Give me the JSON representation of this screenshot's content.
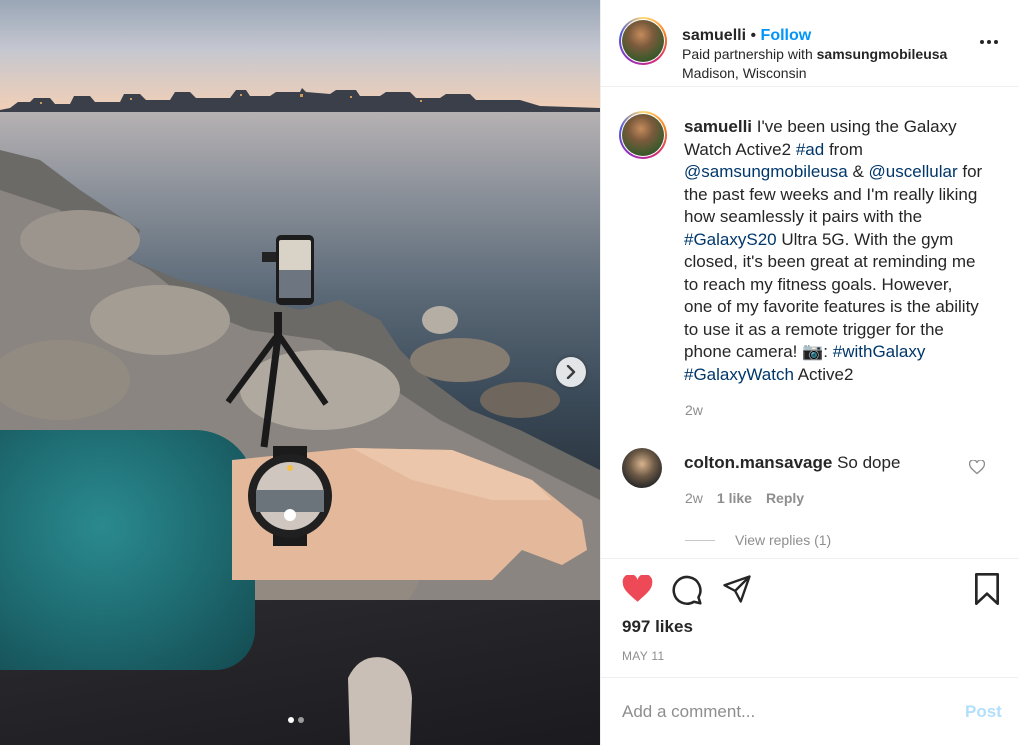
{
  "post": {
    "username": "samuelli",
    "bullet": "•",
    "follow_label": "Follow",
    "partnership_prefix": "Paid partnership with",
    "partner": "samsungmobileusa",
    "location": "Madison, Wisconsin"
  },
  "caption": {
    "username": "samuelli",
    "t1": "I've been using the Galaxy Watch Active2",
    "tag_ad": "#ad",
    "t2": "from",
    "mention1": "@samsungmobileusa",
    "t3": "&",
    "mention2": "@uscellular",
    "t4": "for the past few weeks and I'm really liking how seamlessly it pairs with the",
    "tag_s20": "#GalaxyS20",
    "t5": "Ultra 5G. With the gym closed, it's been great at reminding me to reach my fitness goals. However, one of my favorite features is the ability to use it as a remote trigger for the phone camera! 📷:",
    "tag_with": "#withGalaxy",
    "tag_watch": "#GalaxyWatch",
    "t6": "Active2",
    "time": "2w"
  },
  "comment": {
    "username": "colton.mansavage",
    "text": "So dope",
    "time": "2w",
    "likes": "1 like",
    "reply_label": "Reply",
    "view_replies": "View replies (1)"
  },
  "engagement": {
    "likes": "997 likes",
    "date": "MAY 11"
  },
  "add_comment": {
    "placeholder": "Add a comment...",
    "post_label": "Post"
  },
  "colors": {
    "heart": "#ed4956",
    "link": "#00376b",
    "follow": "#0095f6",
    "post_disabled": "#b2dffc"
  },
  "icons": {
    "like": "heart-icon",
    "comment": "speech-bubble-icon",
    "share": "paper-plane-icon",
    "save": "bookmark-icon",
    "more": "ellipsis-icon",
    "next": "chevron-right-icon"
  },
  "carousel": {
    "slides": 2,
    "active_index": 0
  }
}
